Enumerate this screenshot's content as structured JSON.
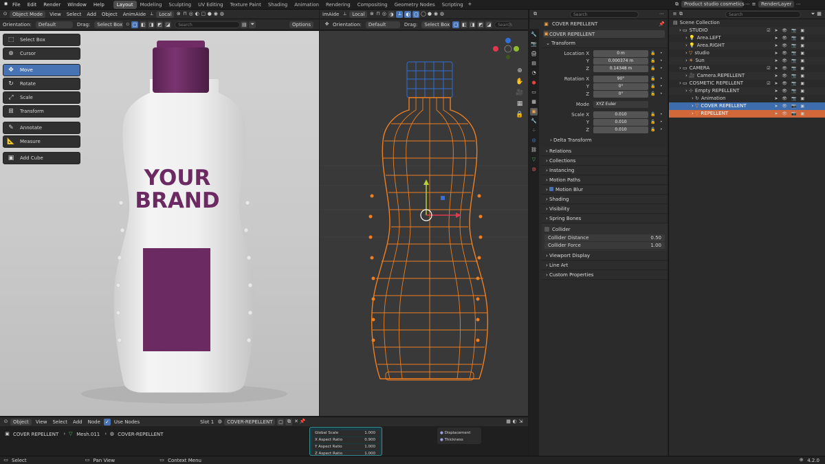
{
  "menu": {
    "items": [
      "File",
      "Edit",
      "Render",
      "Window",
      "Help"
    ]
  },
  "workspaces": [
    {
      "label": "Layout",
      "active": true
    },
    {
      "label": "Modeling"
    },
    {
      "label": "Sculpting"
    },
    {
      "label": "UV Editing"
    },
    {
      "label": "Texture Paint"
    },
    {
      "label": "Shading"
    },
    {
      "label": "Animation"
    },
    {
      "label": "Rendering"
    },
    {
      "label": "Compositing"
    },
    {
      "label": "Geometry Nodes"
    },
    {
      "label": "Scripting"
    }
  ],
  "scene_name": "Product studio cosmetics",
  "render_layer": "RenderLayer",
  "viewport_header": {
    "mode": "Object Mode",
    "view": "View",
    "select": "Select",
    "add": "Add",
    "object": "Object",
    "animaide": "AnimAide",
    "transform_space": "Local",
    "animaide2": "imAide",
    "local2": "Local"
  },
  "left_tool_header": {
    "orientation_label": "Orientation:",
    "orientation": "Default",
    "drag_label": "Drag:",
    "drag": "Select Box",
    "search_placeholder": "Search",
    "options": "Options"
  },
  "right_tool_header": {
    "orientation_label": "Orientation:",
    "orientation": "Default",
    "drag_label": "Drag:",
    "drag": "Select Box",
    "search_placeholder": "Search"
  },
  "toolbar": [
    {
      "label": "Select Box",
      "icon": "select-box-icon",
      "glyph": "⬚"
    },
    {
      "label": "Cursor",
      "icon": "cursor-icon",
      "glyph": "⊕",
      "gap": true
    },
    {
      "label": "Move",
      "icon": "move-icon",
      "glyph": "✥",
      "active": true
    },
    {
      "label": "Rotate",
      "icon": "rotate-icon",
      "glyph": "↻"
    },
    {
      "label": "Scale",
      "icon": "scale-icon",
      "glyph": "⤢"
    },
    {
      "label": "Transform",
      "icon": "transform-icon",
      "glyph": "⊞",
      "gap": true
    },
    {
      "label": "Annotate",
      "icon": "annotate-icon",
      "glyph": "✎"
    },
    {
      "label": "Measure",
      "icon": "measure-icon",
      "glyph": "📐",
      "gap": true
    },
    {
      "label": "Add Cube",
      "icon": "add-cube-icon",
      "glyph": "▣"
    }
  ],
  "bottle": {
    "brand_line1": "YOUR",
    "brand_line2": "BRAND",
    "purple": "#6b2a61",
    "body": "#ececec"
  },
  "properties": {
    "search_placeholder": "Search",
    "object_path": "COVER REPELLENT",
    "object_name": "COVER REPELLENT",
    "transform": {
      "title": "Transform",
      "location": {
        "label": "Location X",
        "x": "0 m",
        "y": "0.000374 m",
        "z": "0.14348 m"
      },
      "rotation": {
        "label": "Rotation X",
        "x": "90°",
        "y": "0°",
        "z": "0°"
      },
      "mode": {
        "label": "Mode",
        "value": "XYZ Euler"
      },
      "scale": {
        "label": "Scale X",
        "x": "0.010",
        "y": "0.010",
        "z": "0.010"
      },
      "axis_y": "Y",
      "axis_z": "Z",
      "delta": "Delta Transform"
    },
    "panels": [
      "Relations",
      "Collections",
      "Instancing",
      "Motion Paths",
      "Motion Blur",
      "Shading",
      "Visibility",
      "Spring Bones"
    ],
    "collider": {
      "label": "Collider",
      "distance_label": "Collider Distance",
      "distance": "0.50",
      "force_label": "Collider Force",
      "force": "1.00"
    },
    "panels2": [
      "Viewport Display",
      "Line Art",
      "Custom Properties"
    ]
  },
  "outliner": {
    "search_placeholder": "Search",
    "rows": [
      {
        "label": "Scene Collection",
        "indent": 0,
        "icon": "scene-collection-icon"
      },
      {
        "label": "STUDIO",
        "indent": 1,
        "icon": "collection-icon",
        "check": true
      },
      {
        "label": "Area.LEFT",
        "indent": 2,
        "icon": "light-icon"
      },
      {
        "label": "Area.RIGHT",
        "indent": 2,
        "icon": "light-icon"
      },
      {
        "label": "studio",
        "indent": 2,
        "icon": "mesh-icon"
      },
      {
        "label": "Sun",
        "indent": 2,
        "icon": "sun-icon"
      },
      {
        "label": "CAMERA",
        "indent": 1,
        "icon": "collection-icon",
        "check": true
      },
      {
        "label": "Camera.REPELLENT",
        "indent": 2,
        "icon": "camera-icon"
      },
      {
        "label": "COSMETIC REPELLENT",
        "indent": 1,
        "icon": "collection-icon",
        "check": true
      },
      {
        "label": "Empty REPELLENT",
        "indent": 2,
        "icon": "empty-icon"
      },
      {
        "label": "Animation",
        "indent": 3,
        "icon": "animation-icon"
      },
      {
        "label": "COVER REPELLENT",
        "indent": 3,
        "icon": "mesh-icon",
        "state": "sel"
      },
      {
        "label": "REPELLENT",
        "indent": 3,
        "icon": "mesh-icon",
        "state": "act"
      }
    ]
  },
  "shader_header": {
    "object": "Object",
    "view": "View",
    "select": "Select",
    "add": "Add",
    "node": "Node",
    "use_nodes": "Use Nodes",
    "slot": "Slot 1",
    "material": "COVER-REPELLENT"
  },
  "breadcrumb": {
    "a": "COVER REPELLENT",
    "b": "Mesh.011",
    "c": "COVER-REPELLENT"
  },
  "node": {
    "rows": [
      {
        "label": "Global Scale",
        "value": "1.000"
      },
      {
        "label": "X Aspect Ratio",
        "value": "0.900"
      },
      {
        "label": "Y Aspect Ratio",
        "value": "1.000"
      },
      {
        "label": "Z Aspect Ratio",
        "value": "1.000"
      }
    ],
    "outputs": [
      "Displacement",
      "Thickness"
    ]
  },
  "status": {
    "select": "Select",
    "pan": "Pan View",
    "context": "Context Menu",
    "version": "4.2.0"
  }
}
